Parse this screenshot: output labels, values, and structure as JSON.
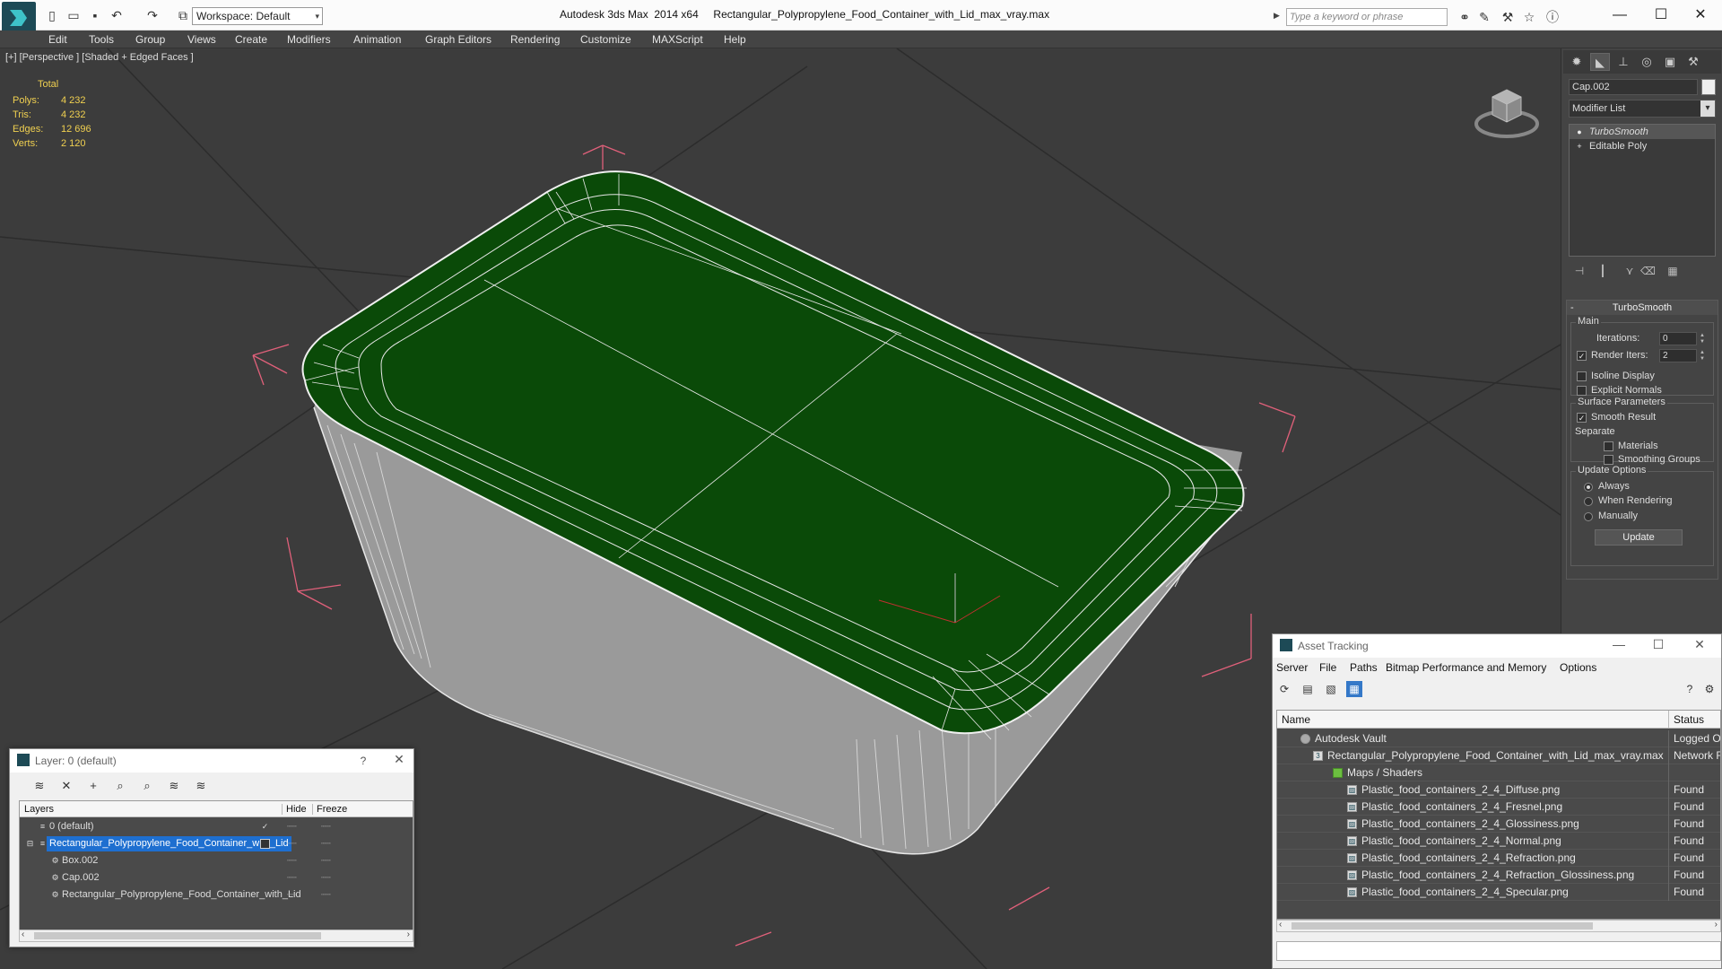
{
  "titlebar": {
    "workspace": "Workspace: Default",
    "window_title": "Autodesk 3ds Max  2014 x64     Rectangular_Polypropylene_Food_Container_with_Lid_max_vray.max",
    "search_placeholder": "Type a keyword or phrase"
  },
  "menu": [
    "Edit",
    "Tools",
    "Group",
    "Views",
    "Create",
    "Modifiers",
    "Animation",
    "Graph Editors",
    "Rendering",
    "Customize",
    "MAXScript",
    "Help"
  ],
  "viewport": {
    "label": "[+] [Perspective ] [Shaded + Edged Faces ]",
    "stats_header": "Total",
    "stats": [
      {
        "key": "Polys:",
        "value": "4 232"
      },
      {
        "key": "Tris:",
        "value": "4 232"
      },
      {
        "key": "Edges:",
        "value": "12 696"
      },
      {
        "key": "Verts:",
        "value": "2 120"
      }
    ]
  },
  "command_panel": {
    "object_name": "Cap.002",
    "modifier_list": "Modifier List",
    "stack": [
      "TurboSmooth",
      "Editable Poly"
    ],
    "rollout_title": "TurboSmooth",
    "main_label": "Main",
    "iterations_label": "Iterations:",
    "iterations_value": "0",
    "render_iters_label": "Render Iters:",
    "render_iters_value": "2",
    "isoline_label": "Isoline Display",
    "explicit_normals_label": "Explicit Normals",
    "surface_params_label": "Surface Parameters",
    "smooth_result_label": "Smooth Result",
    "separate_label": "Separate",
    "materials_label": "Materials",
    "smoothing_groups_label": "Smoothing Groups",
    "update_options_label": "Update Options",
    "always_label": "Always",
    "when_rendering_label": "When Rendering",
    "manually_label": "Manually",
    "update_button": "Update"
  },
  "layer_dialog": {
    "title": "Layer: 0 (default)",
    "help": "?",
    "col_layers": "Layers",
    "col_hide": "Hide",
    "col_freeze": "Freeze",
    "rows": [
      {
        "name": "0 (default)",
        "indent": 1
      },
      {
        "name": "Rectangular_Polypropylene_Food_Container_with_Lid",
        "indent": 1
      },
      {
        "name": "Box.002",
        "indent": 2
      },
      {
        "name": "Cap.002",
        "indent": 2
      },
      {
        "name": "Rectangular_Polypropylene_Food_Container_with_Lid",
        "indent": 2
      }
    ]
  },
  "asset_dialog": {
    "title": "Asset Tracking",
    "menu": [
      "Server",
      "File",
      "Paths",
      "Bitmap Performance and Memory",
      "Options"
    ],
    "col_name": "Name",
    "col_status": "Status",
    "rows": [
      {
        "name": "Autodesk Vault",
        "status": "Logged O"
      },
      {
        "name": "Rectangular_Polypropylene_Food_Container_with_Lid_max_vray.max",
        "status": "Network F"
      },
      {
        "name": "Maps / Shaders",
        "status": ""
      },
      {
        "name": "Plastic_food_containers_2_4_Diffuse.png",
        "status": "Found"
      },
      {
        "name": "Plastic_food_containers_2_4_Fresnel.png",
        "status": "Found"
      },
      {
        "name": "Plastic_food_containers_2_4_Glossiness.png",
        "status": "Found"
      },
      {
        "name": "Plastic_food_containers_2_4_Normal.png",
        "status": "Found"
      },
      {
        "name": "Plastic_food_containers_2_4_Refraction.png",
        "status": "Found"
      },
      {
        "name": "Plastic_food_containers_2_4_Refraction_Glossiness.png",
        "status": "Found"
      },
      {
        "name": "Plastic_food_containers_2_4_Specular.png",
        "status": "Found"
      }
    ]
  },
  "colors": {
    "lid_green": "#0a4a08",
    "wire_white": "#e8e8e8",
    "bbox_pink": "#e0607a",
    "stats_yellow": "#f0d050",
    "selection_blue": "#1e6fd0"
  }
}
